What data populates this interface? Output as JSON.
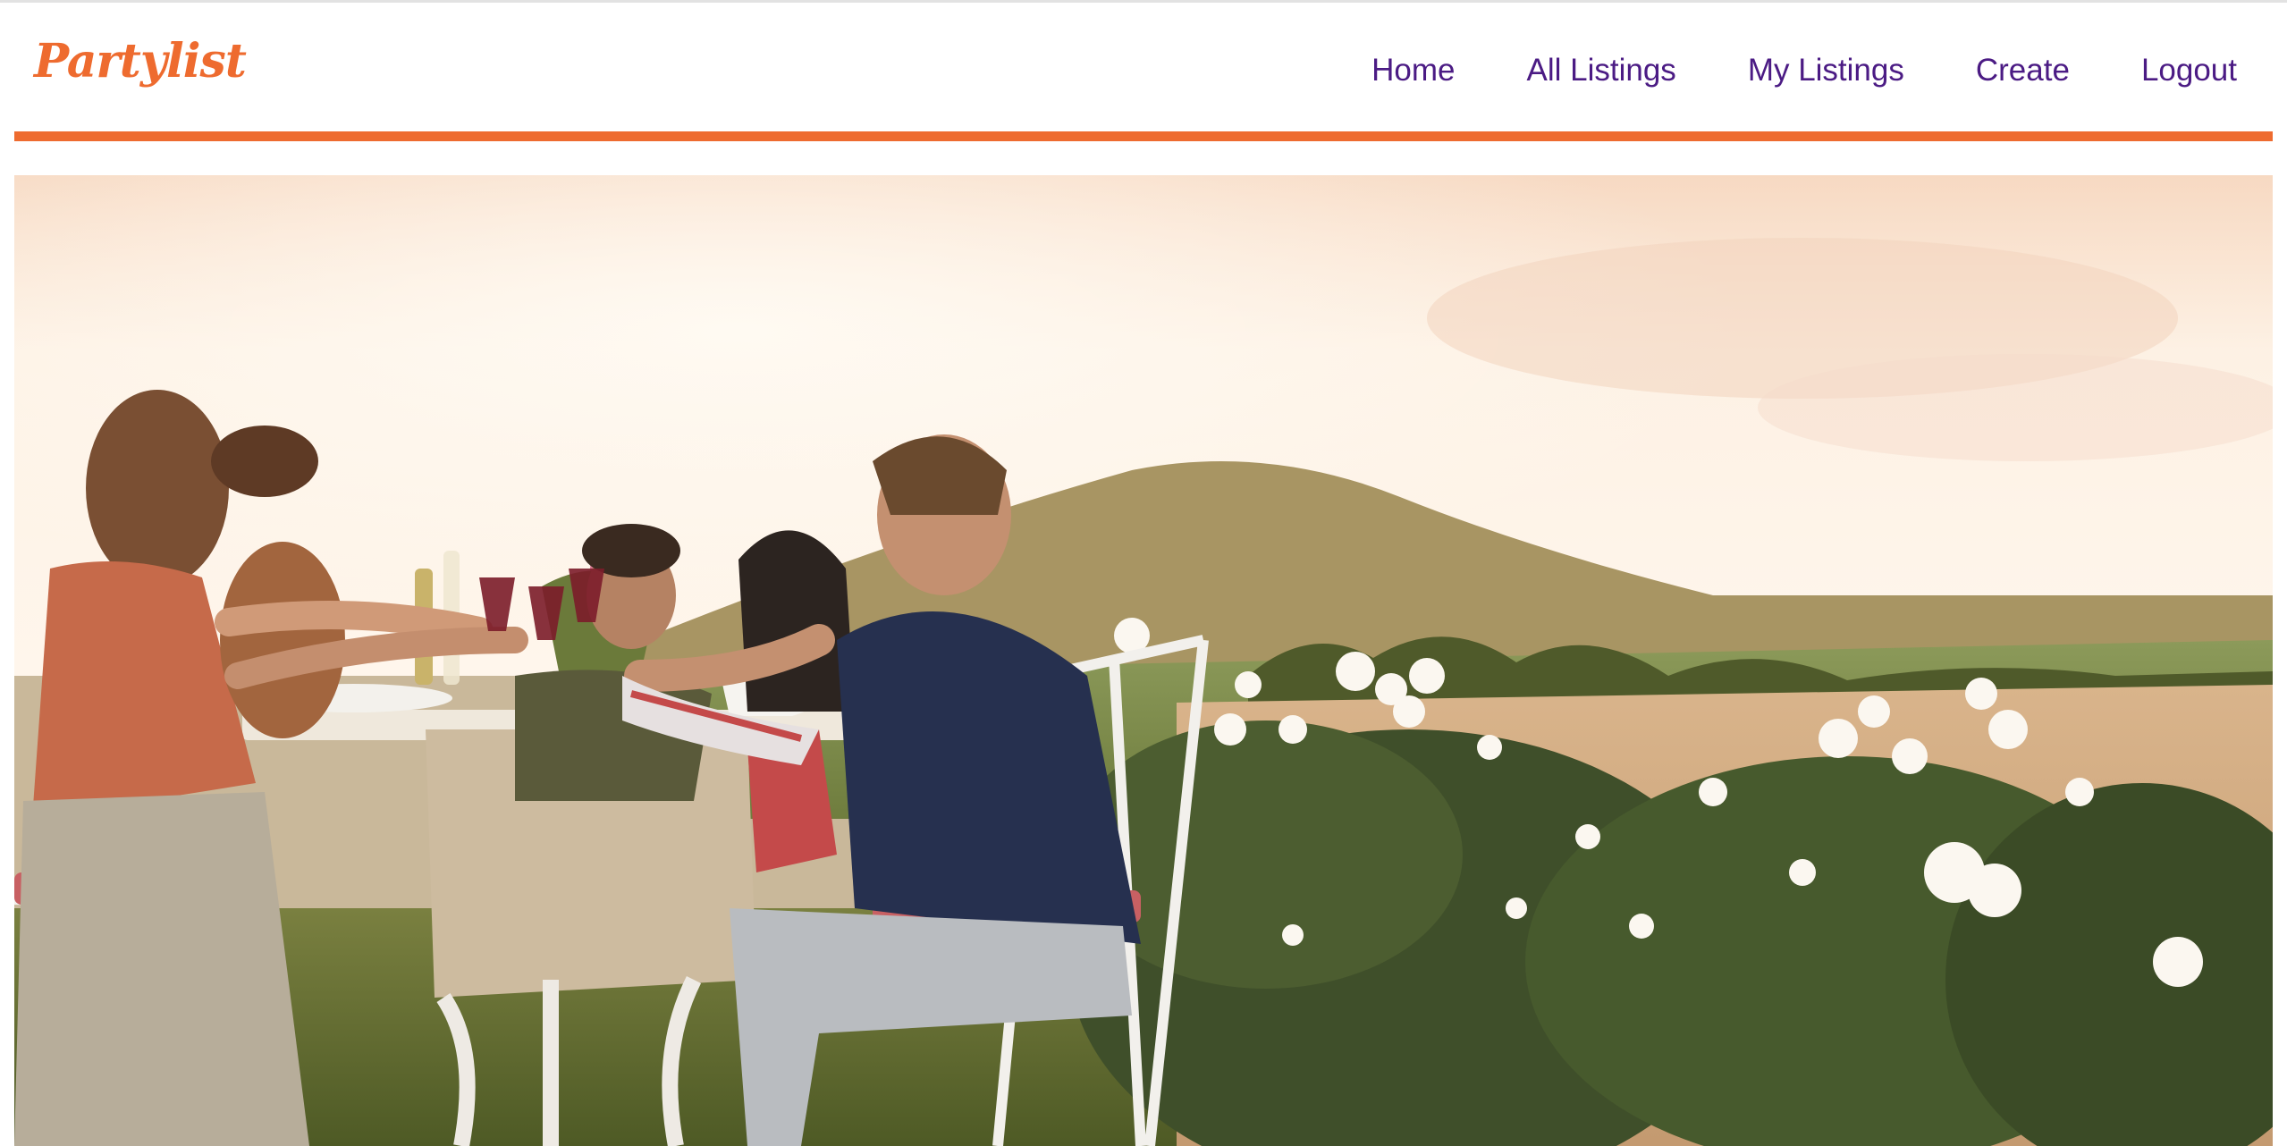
{
  "brand": {
    "name": "Partylist",
    "color": "#ee6b2f"
  },
  "nav": {
    "items": [
      {
        "label": "Home"
      },
      {
        "label": "All Listings"
      },
      {
        "label": "My Listings"
      },
      {
        "label": "Create"
      },
      {
        "label": "Logout"
      }
    ],
    "link_color": "#4b1b84"
  },
  "accent_color": "#ee6b2f",
  "hero": {
    "image": "friends-toasting-at-outdoor-dinner-photo"
  }
}
